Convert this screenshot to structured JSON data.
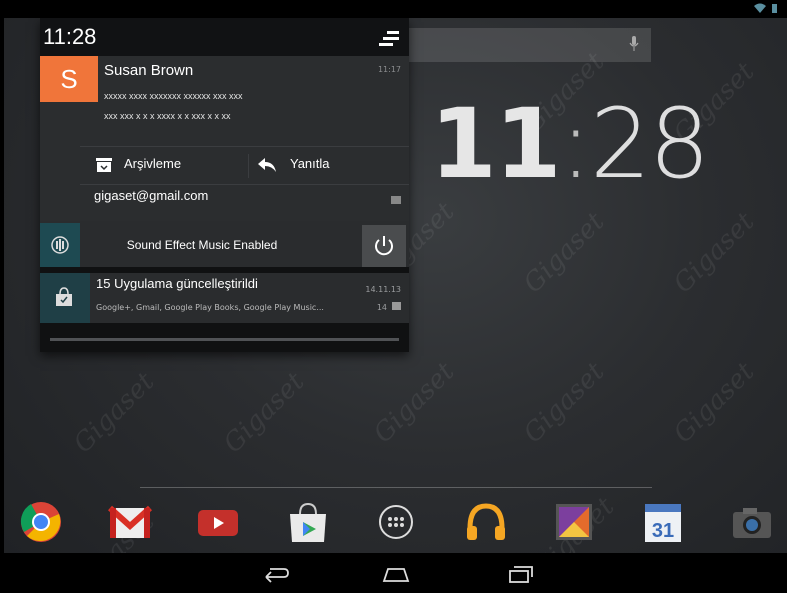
{
  "statusbar": {
    "wifi_icon": "wifi-icon",
    "battery_icon": "battery-icon"
  },
  "shade": {
    "time": "11:28",
    "settings_icon": "quick-settings-icon"
  },
  "email_notification": {
    "avatar_letter": "S",
    "avatar_color": "#f0753a",
    "sender": "Susan Brown",
    "time": "11:17",
    "line1": "xxxxx xxxx xxxxxxx xxxxxx xxx xxx",
    "line2": "xxx xxx x x x xxxx x x xxx x x xx",
    "archive_label": "Arşivleme",
    "reply_label": "Yanıtla",
    "account": "gigaset@gmail.com"
  },
  "sound_notification": {
    "text": "Sound Effect Music Enabled",
    "icon": "sound-wave-icon",
    "power_icon": "power-icon"
  },
  "updates_notification": {
    "title": "15 Uygulama güncelleştirildi",
    "subtitle": "Google+, Gmail, Google Play Books, Google Play Music...",
    "date": "14.11.13",
    "count": "14"
  },
  "home": {
    "clock_hours": "11",
    "clock_colon": ":",
    "clock_minutes": "28",
    "watermark": "Gigaset"
  },
  "dock": [
    {
      "name": "chrome-icon"
    },
    {
      "name": "gmail-icon"
    },
    {
      "name": "youtube-icon"
    },
    {
      "name": "play-store-icon"
    },
    {
      "name": "app-drawer-icon"
    },
    {
      "name": "play-music-icon"
    },
    {
      "name": "gallery-icon"
    },
    {
      "name": "calendar-icon",
      "day": "31"
    },
    {
      "name": "camera-icon"
    }
  ],
  "navbar": {
    "back": "back-icon",
    "home": "home-icon",
    "recents": "recents-icon"
  }
}
